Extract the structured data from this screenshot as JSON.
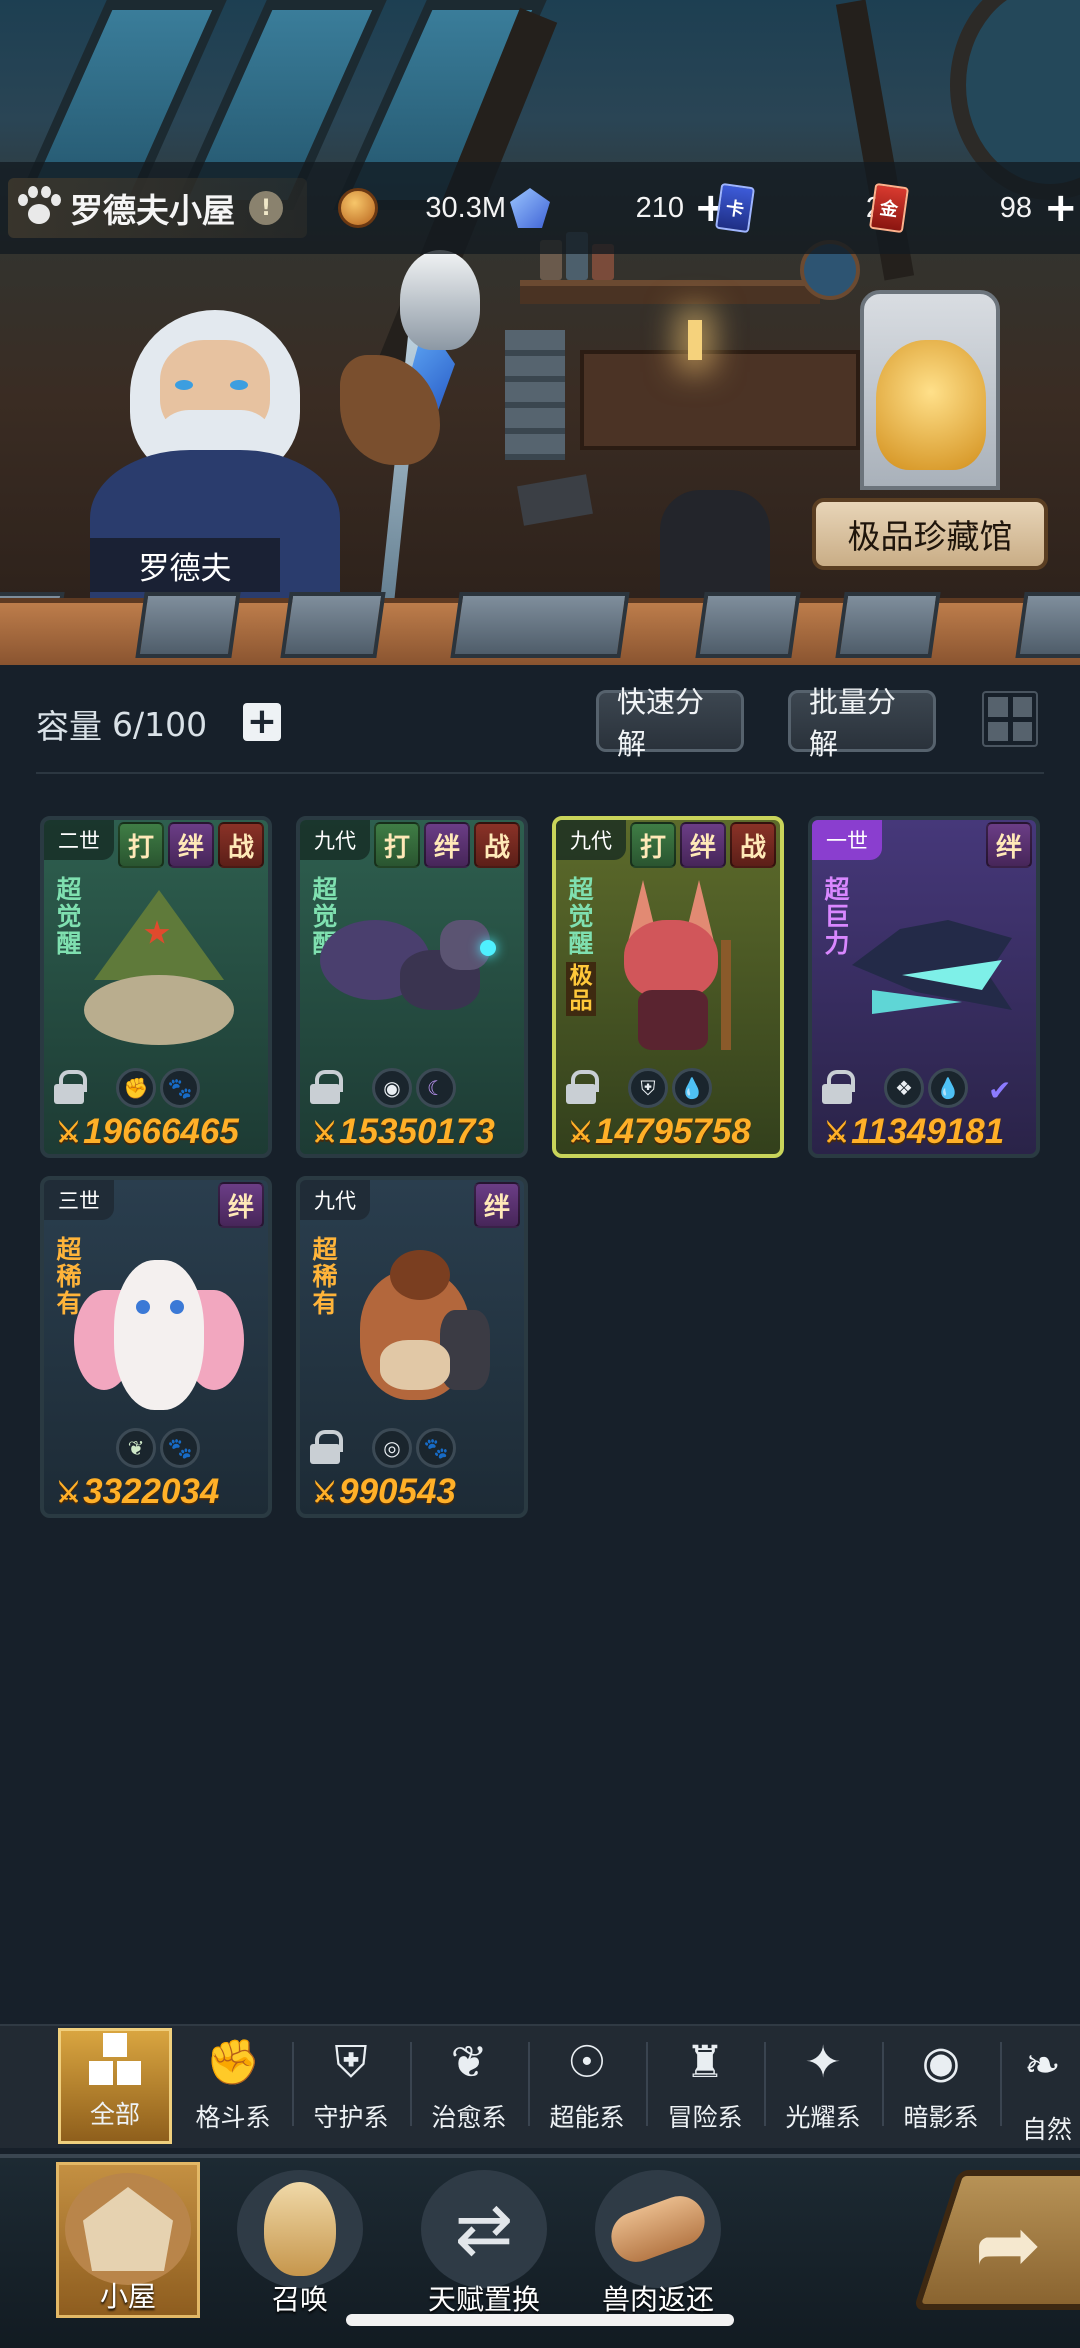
{
  "hud": {
    "house_name": "罗德夫小屋",
    "alert_icon": "!",
    "coins": "30.3M",
    "crystals": "210",
    "card_tickets": "2",
    "card_ticket_label": "卡",
    "gold_tickets": "98",
    "gold_ticket_label": "金"
  },
  "scene": {
    "npc_name": "罗德夫",
    "museum_label": "极品珍藏馆"
  },
  "inventory": {
    "capacity_label": "容量",
    "capacity_value": "6/100",
    "quick_decompose": "快速分解",
    "batch_decompose": "批量分解"
  },
  "pets": [
    {
      "generation": "二世",
      "tags": [
        "打",
        "绊",
        "战"
      ],
      "label1": "超觉醒",
      "label2": "",
      "power": "19666465",
      "elements": [
        "fist-icon",
        "paw-icon"
      ]
    },
    {
      "generation": "九代",
      "tags": [
        "打",
        "绊",
        "战"
      ],
      "label1": "超觉醒",
      "label2": "",
      "power": "15350173",
      "elements": [
        "eye-icon",
        "moon-icon"
      ]
    },
    {
      "generation": "九代",
      "tags": [
        "打",
        "绊",
        "战"
      ],
      "label1": "超觉醒",
      "label2": "极品",
      "power": "14795758",
      "elements": [
        "shield-icon",
        "water-icon"
      ]
    },
    {
      "generation": "一世",
      "tags": [
        "绊"
      ],
      "label1": "超巨力",
      "label2": "",
      "power": "11349181",
      "elements": [
        "crystal-icon",
        "water-icon"
      ]
    },
    {
      "generation": "三世",
      "tags": [
        "绊"
      ],
      "label1": "超稀有",
      "label2": "",
      "power": "3322034",
      "elements": [
        "sprout-icon",
        "paw-icon"
      ]
    },
    {
      "generation": "九代",
      "tags": [
        "绊"
      ],
      "label1": "超稀有",
      "label2": "",
      "power": "990543",
      "elements": [
        "target-icon",
        "paw-icon"
      ]
    }
  ],
  "filters": [
    "全部",
    "格斗系",
    "守护系",
    "治愈系",
    "超能系",
    "冒险系",
    "光耀系",
    "暗影系",
    "自然"
  ],
  "nav": [
    "小屋",
    "召唤",
    "天赋置换",
    "兽肉返还"
  ],
  "colors": {
    "power": "#ffb028",
    "tag_fight": "#3f7d45",
    "tag_bond": "#6b3d86",
    "tag_battle": "#8a3227",
    "selected_gold": "#d9a540"
  }
}
